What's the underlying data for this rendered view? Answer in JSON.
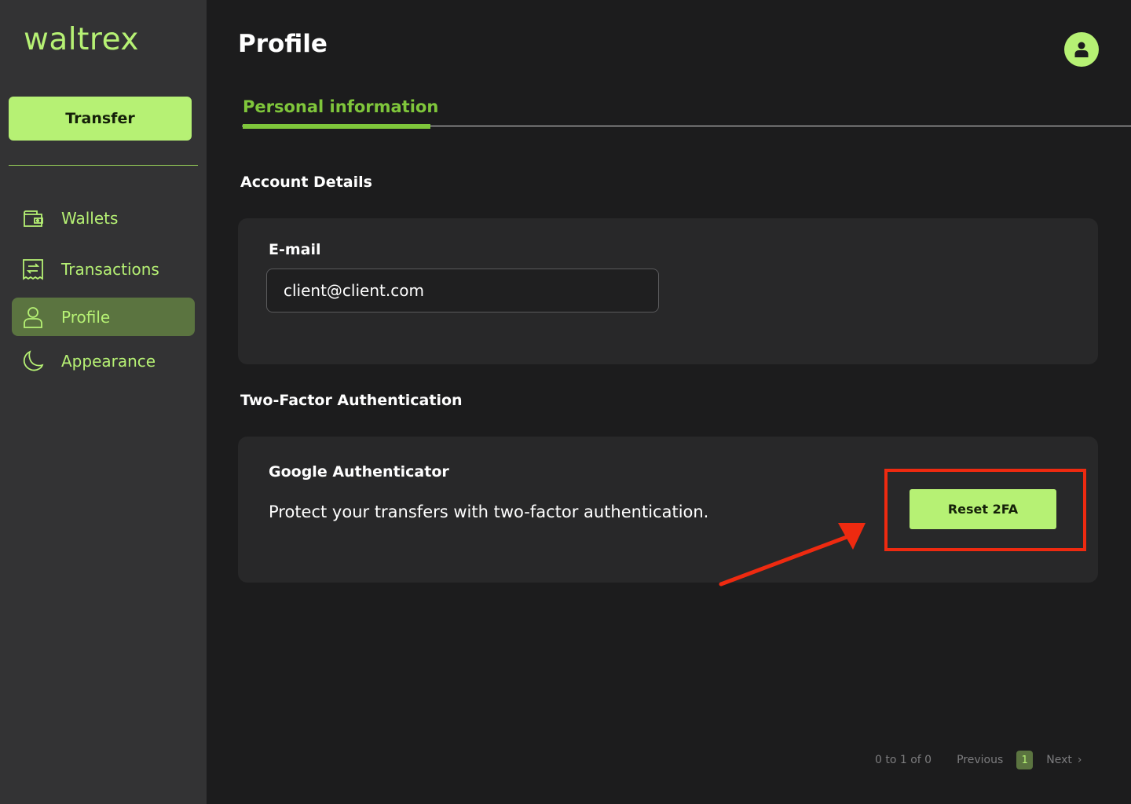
{
  "app": {
    "logo": "waltrex",
    "accent": "#b6f174",
    "warning": "#ee2a10"
  },
  "sidebar": {
    "transfer_label": "Transfer",
    "items": [
      {
        "label": "Wallets",
        "icon": "wallet-icon"
      },
      {
        "label": "Transactions",
        "icon": "receipt-icon"
      },
      {
        "label": "Profile",
        "icon": "user-icon",
        "active": true
      },
      {
        "label": "Appearance",
        "icon": "moon-icon"
      }
    ]
  },
  "header": {
    "title": "Profile",
    "avatar_icon": "user-avatar-icon"
  },
  "tabs": [
    {
      "label": "Personal information",
      "active": true
    }
  ],
  "account": {
    "section_title": "Account Details",
    "email_label": "E-mail",
    "email_value": "client@client.com"
  },
  "twofa": {
    "section_title": "Two-Factor Authentication",
    "card_title": "Google Authenticator",
    "description": "Protect your transfers with two-factor authentication.",
    "button_label": "Reset 2FA"
  },
  "pagination": {
    "range": "0 to 1 of 0",
    "previous": "Previous",
    "page": "1",
    "next": "Next",
    "next_icon": "chevron-right-icon"
  }
}
